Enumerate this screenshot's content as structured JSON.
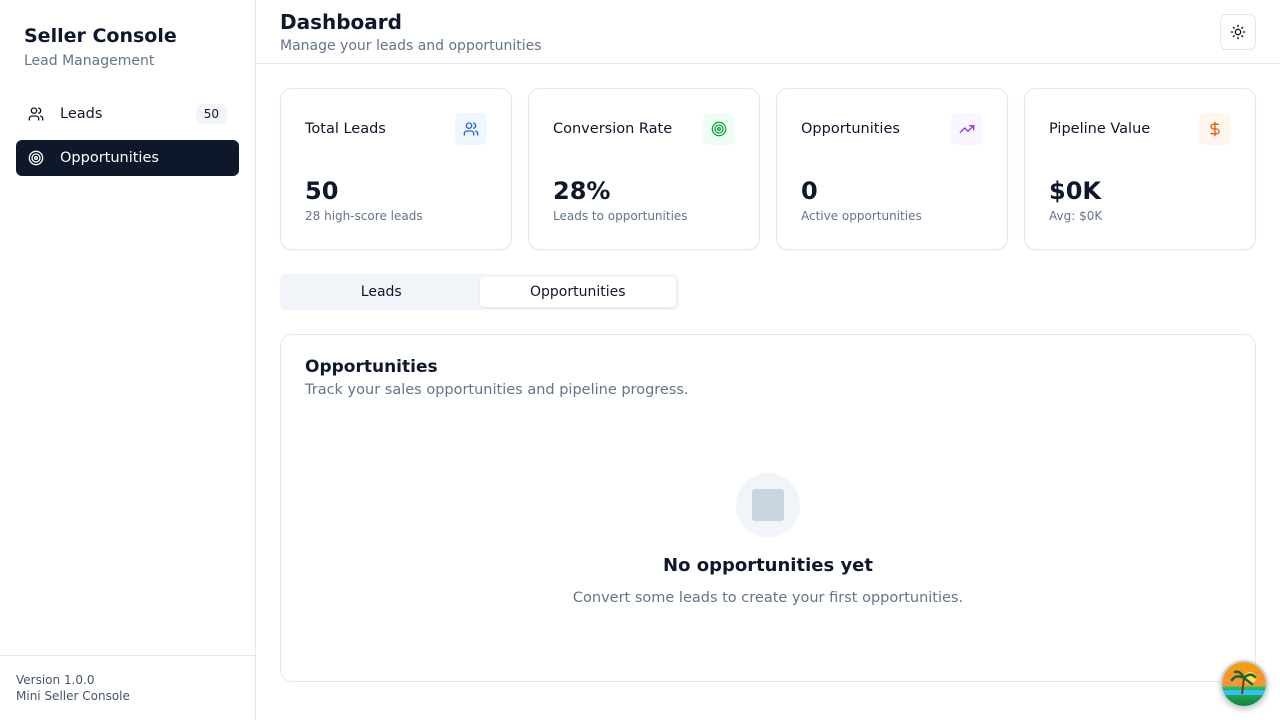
{
  "sidebar": {
    "brand_title": "Seller Console",
    "brand_subtitle": "Lead Management",
    "items": [
      {
        "label": "Leads",
        "badge": "50",
        "icon": "users-icon"
      },
      {
        "label": "Opportunities",
        "icon": "target-icon",
        "active": true
      }
    ],
    "footer": {
      "version": "Version 1.0.0",
      "app_name": "Mini Seller Console"
    }
  },
  "header": {
    "title": "Dashboard",
    "subtitle": "Manage your leads and opportunities",
    "theme_icon": "sun-icon"
  },
  "stats": [
    {
      "label": "Total Leads",
      "value": "50",
      "sub": "28 high-score leads",
      "icon": "users-icon",
      "accent": "#2563eb",
      "bg": "#eff6ff"
    },
    {
      "label": "Conversion Rate",
      "value": "28%",
      "sub": "Leads to opportunities",
      "icon": "target-icon",
      "accent": "#16a34a",
      "bg": "#f0fdf4"
    },
    {
      "label": "Opportunities",
      "value": "0",
      "sub": "Active opportunities",
      "icon": "trending-up-icon",
      "accent": "#9333ea",
      "bg": "#faf5ff"
    },
    {
      "label": "Pipeline Value",
      "value": "$0K",
      "sub": "Avg: $0K",
      "icon": "dollar-icon",
      "accent": "#ea580c",
      "bg": "#fff7ed"
    }
  ],
  "tabs": [
    {
      "label": "Leads",
      "active": false
    },
    {
      "label": "Opportunities",
      "active": true
    }
  ],
  "panel": {
    "title": "Opportunities",
    "subtitle": "Track your sales opportunities and pipeline progress.",
    "empty_title": "No opportunities yet",
    "empty_subtitle": "Convert some leads to create your first opportunities."
  }
}
